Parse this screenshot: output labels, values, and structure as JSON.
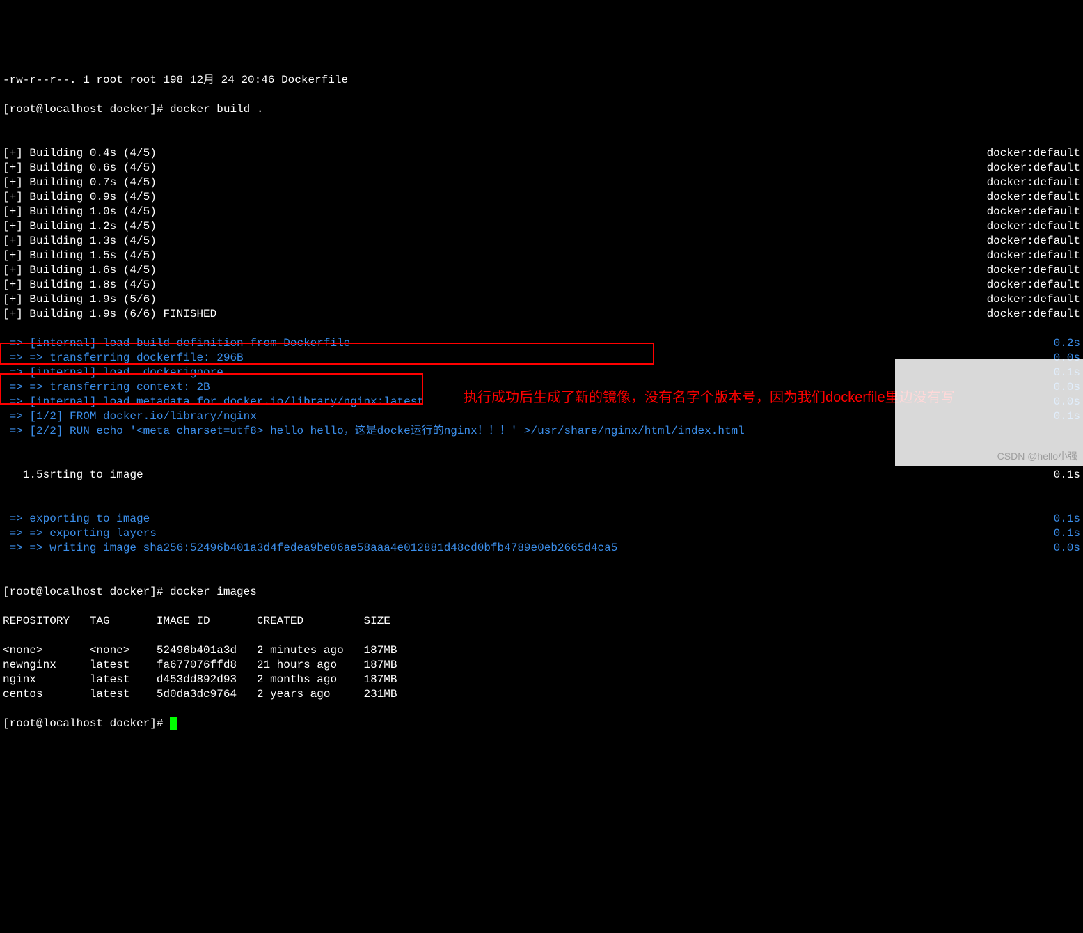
{
  "header": {
    "ls_line": "-rw-r--r--. 1 root root 198 12月 24 20:46 Dockerfile",
    "prompt1": "[root@localhost docker]# docker build ."
  },
  "builds": [
    {
      "left": "[+] Building 0.4s (4/5)",
      "right": "docker:default"
    },
    {
      "left": "[+] Building 0.6s (4/5)",
      "right": "docker:default"
    },
    {
      "left": "[+] Building 0.7s (4/5)",
      "right": "docker:default"
    },
    {
      "left": "[+] Building 0.9s (4/5)",
      "right": "docker:default"
    },
    {
      "left": "[+] Building 1.0s (4/5)",
      "right": "docker:default"
    },
    {
      "left": "[+] Building 1.2s (4/5)",
      "right": "docker:default"
    },
    {
      "left": "[+] Building 1.3s (4/5)",
      "right": "docker:default"
    },
    {
      "left": "[+] Building 1.5s (4/5)",
      "right": "docker:default"
    },
    {
      "left": "[+] Building 1.6s (4/5)",
      "right": "docker:default"
    },
    {
      "left": "[+] Building 1.8s (4/5)",
      "right": "docker:default"
    },
    {
      "left": "[+] Building 1.9s (5/6)",
      "right": "docker:default"
    },
    {
      "left": "[+] Building 1.9s (6/6) FINISHED",
      "right": "docker:default"
    }
  ],
  "steps": [
    {
      "left": " => [internal] load build definition from Dockerfile",
      "right": "0.2s"
    },
    {
      "left": " => => transferring dockerfile: 296B",
      "right": "0.0s"
    },
    {
      "left": " => [internal] load .dockerignore",
      "right": "0.1s"
    },
    {
      "left": " => => transferring context: 2B",
      "right": "0.0s"
    },
    {
      "left": " => [internal] load metadata for docker.io/library/nginx:latest",
      "right": "0.0s"
    },
    {
      "left": " => [1/2] FROM docker.io/library/nginx",
      "right": "0.1s"
    },
    {
      "left": " => [2/2] RUN echo '<meta charset=utf8> hello hello，这是docke运行的nginx！！！' >/usr/share/nginx/html/index.html",
      "right": ""
    }
  ],
  "mixed_line": {
    "left_white": "   1.5s",
    "left_rest": "rting to image",
    "right": "0.1s"
  },
  "export_steps": [
    {
      "left": " => exporting to image",
      "right": "0.1s"
    },
    {
      "left": " => => exporting layers",
      "right": "0.1s"
    },
    {
      "left": " => => writing image sha256:52496b401a3d4fedea9be06ae58aaa4e012881d48cd0bfb4789e0eb2665d4ca5",
      "right": "0.0s"
    }
  ],
  "prompt2": "[root@localhost docker]# docker images",
  "table": {
    "header": "REPOSITORY   TAG       IMAGE ID       CREATED         SIZE",
    "rows": [
      "<none>       <none>    52496b401a3d   2 minutes ago   187MB",
      "newnginx     latest    fa677076ffd8   21 hours ago    187MB",
      "nginx        latest    d453dd892d93   2 months ago    187MB",
      "centos       latest    5d0da3dc9764   2 years ago     231MB"
    ]
  },
  "prompt3": "[root@localhost docker]# ",
  "annotation": "执行成功后生成了新的镜像，没有名字个版本号，因为我们dockerfile里边没有写",
  "watermark": "CSDN @hello小强"
}
